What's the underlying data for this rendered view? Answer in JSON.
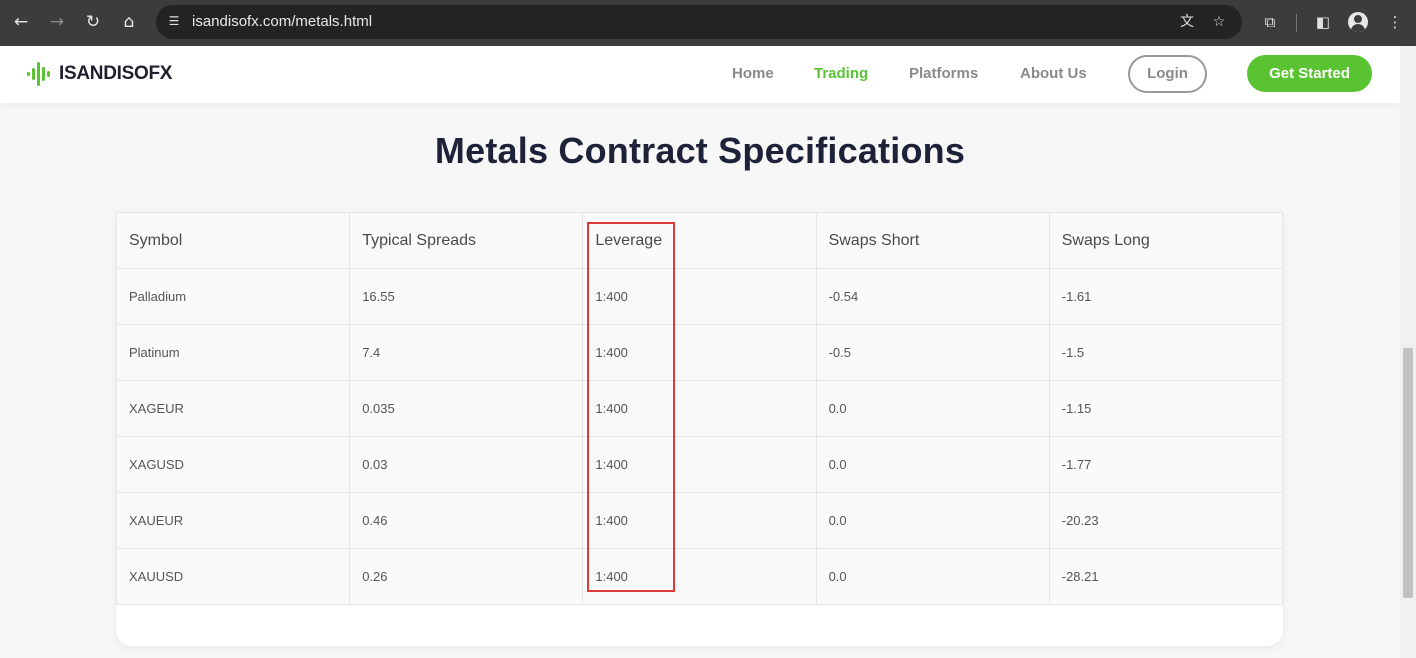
{
  "browser": {
    "url": "isandisofx.com/metals.html",
    "icons": [
      "back-icon",
      "forward-icon",
      "reload-icon",
      "home-icon",
      "site-info-icon",
      "translate-icon",
      "bookmark-star-icon",
      "extensions-icon",
      "side-panel-icon",
      "profile-icon",
      "more-menu-icon"
    ]
  },
  "site": {
    "logo_text": "ISANDISOFX",
    "nav": [
      {
        "label": "Home",
        "active": false
      },
      {
        "label": "Trading",
        "active": true
      },
      {
        "label": "Platforms",
        "active": false
      },
      {
        "label": "About Us",
        "active": false
      }
    ],
    "login_label": "Login",
    "cta_label": "Get Started",
    "accent_color": "#59c332"
  },
  "main": {
    "title": "Metals Contract Specifications",
    "columns": [
      "Symbol",
      "Typical Spreads",
      "Leverage",
      "Swaps Short",
      "Swaps Long"
    ],
    "rows": [
      [
        "Palladium",
        "16.55",
        "1:400",
        "-0.54",
        "-1.61"
      ],
      [
        "Platinum",
        "7.4",
        "1:400",
        "-0.5",
        "-1.5"
      ],
      [
        "XAGEUR",
        "0.035",
        "1:400",
        "0.0",
        "-1.15"
      ],
      [
        "XAGUSD",
        "0.03",
        "1:400",
        "0.0",
        "-1.77"
      ],
      [
        "XAUEUR",
        "0.46",
        "1:400",
        "0.0",
        "-20.23"
      ],
      [
        "XAUUSD",
        "0.26",
        "1:400",
        "0.0",
        "-28.21"
      ]
    ],
    "highlight_color": "#e03a3a"
  }
}
